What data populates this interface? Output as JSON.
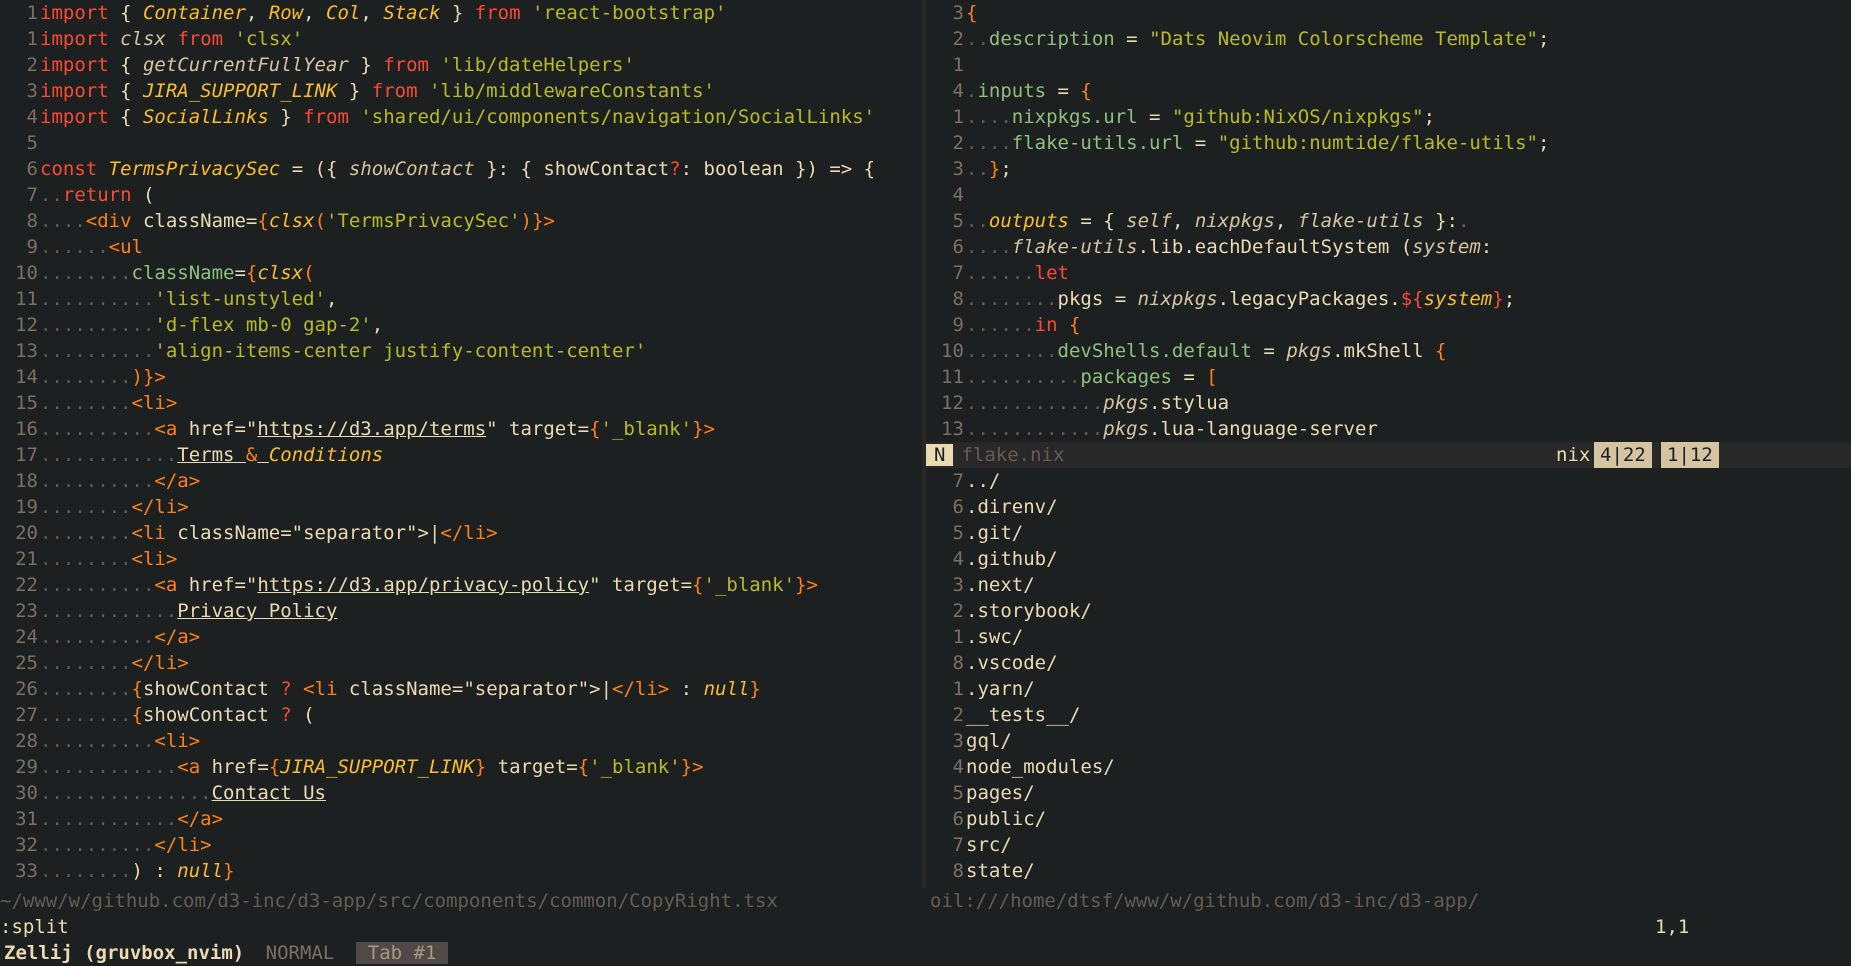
{
  "left": {
    "lines": [
      {
        "n": "1",
        "segs": [
          [
            "kw",
            "import"
          ],
          [
            "plain",
            " { "
          ],
          [
            "id",
            "Container"
          ],
          [
            "plain",
            ", "
          ],
          [
            "id",
            "Row"
          ],
          [
            "plain",
            ", "
          ],
          [
            "id",
            "Col"
          ],
          [
            "plain",
            ", "
          ],
          [
            "id",
            "Stack"
          ],
          [
            "plain",
            " } "
          ],
          [
            "kw",
            "from"
          ],
          [
            "plain",
            " "
          ],
          [
            "str",
            "'react-bootstrap'"
          ]
        ]
      },
      {
        "n": "1",
        "segs": [
          [
            "kw",
            "import"
          ],
          [
            "plain",
            " "
          ],
          [
            "it",
            "clsx"
          ],
          [
            "plain",
            " "
          ],
          [
            "kw",
            "from"
          ],
          [
            "plain",
            " "
          ],
          [
            "str",
            "'clsx'"
          ]
        ]
      },
      {
        "n": "2",
        "segs": [
          [
            "kw",
            "import"
          ],
          [
            "plain",
            " { "
          ],
          [
            "it",
            "getCurrentFullYear"
          ],
          [
            "plain",
            " } "
          ],
          [
            "kw",
            "from"
          ],
          [
            "plain",
            " "
          ],
          [
            "str",
            "'lib/dateHelpers'"
          ]
        ]
      },
      {
        "n": "3",
        "segs": [
          [
            "kw",
            "import"
          ],
          [
            "plain",
            " { "
          ],
          [
            "id",
            "JIRA_SUPPORT_LINK"
          ],
          [
            "plain",
            " } "
          ],
          [
            "kw",
            "from"
          ],
          [
            "plain",
            " "
          ],
          [
            "str",
            "'lib/middlewareConstants'"
          ]
        ]
      },
      {
        "n": "4",
        "segs": [
          [
            "kw",
            "import"
          ],
          [
            "plain",
            " { "
          ],
          [
            "id",
            "SocialLinks"
          ],
          [
            "plain",
            " } "
          ],
          [
            "kw",
            "from"
          ],
          [
            "plain",
            " "
          ],
          [
            "str",
            "'shared/ui/components/navigation/SocialLinks'"
          ]
        ]
      },
      {
        "n": "5",
        "segs": []
      },
      {
        "n": "6",
        "segs": [
          [
            "kw",
            "const"
          ],
          [
            "plain",
            " "
          ],
          [
            "id",
            "TermsPrivacySec"
          ],
          [
            "plain",
            " = ({ "
          ],
          [
            "it",
            "showContact"
          ],
          [
            "plain",
            " }: { showContact"
          ],
          [
            "kw",
            "?"
          ],
          [
            "plain",
            ": boolean }) => {"
          ]
        ]
      },
      {
        "n": "7",
        "segs": [
          [
            "dot",
            ".."
          ],
          [
            "kw",
            "return"
          ],
          [
            "plain",
            " ("
          ]
        ]
      },
      {
        "n": "8",
        "segs": [
          [
            "dot",
            "...."
          ],
          [
            "jsx",
            "<div"
          ],
          [
            "plain",
            " className="
          ],
          [
            "jsx",
            "{"
          ],
          [
            "id",
            "clsx"
          ],
          [
            "jsx",
            "("
          ],
          [
            "str",
            "'TermsPrivacySec'"
          ],
          [
            "jsx",
            ")}"
          ],
          [
            "jsx",
            ">"
          ]
        ]
      },
      {
        "n": "9",
        "segs": [
          [
            "dot",
            "......"
          ],
          [
            "jsx",
            "<ul"
          ]
        ]
      },
      {
        "n": "10",
        "segs": [
          [
            "dot",
            "........"
          ],
          [
            "attr",
            "className"
          ],
          [
            "plain",
            "="
          ],
          [
            "jsx",
            "{"
          ],
          [
            "id",
            "clsx"
          ],
          [
            "jsx",
            "("
          ]
        ]
      },
      {
        "n": "11",
        "segs": [
          [
            "dot",
            ".........."
          ],
          [
            "str",
            "'list-unstyled'"
          ],
          [
            "plain",
            ","
          ]
        ]
      },
      {
        "n": "12",
        "segs": [
          [
            "dot",
            ".........."
          ],
          [
            "str",
            "'d-flex mb-0 gap-2'"
          ],
          [
            "plain",
            ","
          ]
        ]
      },
      {
        "n": "13",
        "segs": [
          [
            "dot",
            ".........."
          ],
          [
            "str",
            "'align-items-center justify-content-center'"
          ]
        ]
      },
      {
        "n": "14",
        "segs": [
          [
            "dot",
            "........"
          ],
          [
            "jsx",
            ")}>"
          ]
        ]
      },
      {
        "n": "15",
        "segs": [
          [
            "dot",
            "........"
          ],
          [
            "jsx",
            "<li>"
          ]
        ]
      },
      {
        "n": "16",
        "segs": [
          [
            "dot",
            ".........."
          ],
          [
            "jsx",
            "<a"
          ],
          [
            "plain",
            " href=\""
          ],
          [
            "link",
            "https://d3.app/terms"
          ],
          [
            "plain",
            "\" target="
          ],
          [
            "jsx",
            "{"
          ],
          [
            "str",
            "'_blank'"
          ],
          [
            "jsx",
            "}>"
          ]
        ]
      },
      {
        "n": "17",
        "segs": [
          [
            "dot",
            "............"
          ],
          [
            "link",
            "Terms "
          ],
          [
            "jsx",
            "&"
          ],
          [
            "link",
            " "
          ],
          [
            "id",
            "Conditions"
          ]
        ]
      },
      {
        "n": "18",
        "segs": [
          [
            "dot",
            ".........."
          ],
          [
            "jsx",
            "</a>"
          ]
        ]
      },
      {
        "n": "19",
        "segs": [
          [
            "dot",
            "........"
          ],
          [
            "jsx",
            "</li>"
          ]
        ]
      },
      {
        "n": "20",
        "segs": [
          [
            "dot",
            "........"
          ],
          [
            "jsx",
            "<li"
          ],
          [
            "plain",
            " className=\"separator\">|"
          ],
          [
            "jsx",
            "</li>"
          ]
        ]
      },
      {
        "n": "21",
        "segs": [
          [
            "dot",
            "........"
          ],
          [
            "jsx",
            "<li>"
          ]
        ]
      },
      {
        "n": "22",
        "segs": [
          [
            "dot",
            ".........."
          ],
          [
            "jsx",
            "<a"
          ],
          [
            "plain",
            " href=\""
          ],
          [
            "link",
            "https://d3.app/privacy-policy"
          ],
          [
            "plain",
            "\" target="
          ],
          [
            "jsx",
            "{"
          ],
          [
            "str",
            "'_blank'"
          ],
          [
            "jsx",
            "}>"
          ]
        ]
      },
      {
        "n": "23",
        "segs": [
          [
            "dot",
            "............"
          ],
          [
            "link",
            "Privacy Policy"
          ]
        ]
      },
      {
        "n": "24",
        "segs": [
          [
            "dot",
            ".........."
          ],
          [
            "jsx",
            "</a>"
          ]
        ]
      },
      {
        "n": "25",
        "segs": [
          [
            "dot",
            "........"
          ],
          [
            "jsx",
            "</li>"
          ]
        ]
      },
      {
        "n": "26",
        "segs": [
          [
            "dot",
            "........"
          ],
          [
            "jsx",
            "{"
          ],
          [
            "plain",
            "showContact "
          ],
          [
            "kw",
            "?"
          ],
          [
            "plain",
            " "
          ],
          [
            "jsx",
            "<li"
          ],
          [
            "plain",
            " className=\"separator\">|"
          ],
          [
            "jsx",
            "</li>"
          ],
          [
            "plain",
            " : "
          ],
          [
            "id",
            "null"
          ],
          [
            "jsx",
            "}"
          ]
        ]
      },
      {
        "n": "27",
        "segs": [
          [
            "dot",
            "........"
          ],
          [
            "jsx",
            "{"
          ],
          [
            "plain",
            "showContact "
          ],
          [
            "kw",
            "?"
          ],
          [
            "plain",
            " ("
          ]
        ]
      },
      {
        "n": "28",
        "segs": [
          [
            "dot",
            ".........."
          ],
          [
            "jsx",
            "<li>"
          ]
        ]
      },
      {
        "n": "29",
        "segs": [
          [
            "dot",
            "............"
          ],
          [
            "jsx",
            "<a"
          ],
          [
            "plain",
            " href="
          ],
          [
            "jsx",
            "{"
          ],
          [
            "id",
            "JIRA_SUPPORT_LINK"
          ],
          [
            "jsx",
            "}"
          ],
          [
            "plain",
            " target="
          ],
          [
            "jsx",
            "{"
          ],
          [
            "str",
            "'_blank'"
          ],
          [
            "jsx",
            "}>"
          ]
        ]
      },
      {
        "n": "30",
        "segs": [
          [
            "dot",
            "..............."
          ],
          [
            "link",
            "Contact Us"
          ]
        ]
      },
      {
        "n": "31",
        "segs": [
          [
            "dot",
            "............"
          ],
          [
            "jsx",
            "</a>"
          ]
        ]
      },
      {
        "n": "32",
        "segs": [
          [
            "dot",
            ".........."
          ],
          [
            "jsx",
            "</li>"
          ]
        ]
      },
      {
        "n": "33",
        "segs": [
          [
            "dot",
            "........"
          ],
          [
            "plain",
            ") : "
          ],
          [
            "id",
            "null"
          ],
          [
            "jsx",
            "}"
          ]
        ]
      }
    ],
    "status_path": "~/www/w/github.com/d3-inc/d3-app/src/components/common/CopyRight.tsx"
  },
  "right": {
    "lines": [
      {
        "n": "3",
        "segs": [
          [
            "jsx",
            "{"
          ]
        ]
      },
      {
        "n": "2",
        "segs": [
          [
            "dot",
            ".."
          ],
          [
            "attr",
            "description"
          ],
          [
            "plain",
            " = "
          ],
          [
            "str",
            "\"Dats Neovim Colorscheme Template\""
          ],
          [
            "plain",
            ";"
          ]
        ]
      },
      {
        "n": "1",
        "segs": []
      },
      {
        "n": "4",
        "segs": [
          [
            "dot",
            "."
          ],
          [
            "attr",
            "inputs"
          ],
          [
            "plain",
            " = "
          ],
          [
            "jsx",
            "{"
          ]
        ]
      },
      {
        "n": "1",
        "segs": [
          [
            "dot",
            "...."
          ],
          [
            "attr",
            "nixpkgs.url"
          ],
          [
            "plain",
            " = "
          ],
          [
            "str",
            "\"github:NixOS/nixpkgs\""
          ],
          [
            "plain",
            ";"
          ]
        ]
      },
      {
        "n": "2",
        "segs": [
          [
            "dot",
            "...."
          ],
          [
            "attr",
            "flake-utils.url"
          ],
          [
            "plain",
            " = "
          ],
          [
            "str",
            "\"github:numtide/flake-utils\""
          ],
          [
            "plain",
            ";"
          ]
        ]
      },
      {
        "n": "3",
        "segs": [
          [
            "dot",
            ".."
          ],
          [
            "jsx",
            "}"
          ],
          [
            "plain",
            ";"
          ]
        ]
      },
      {
        "n": "4",
        "segs": []
      },
      {
        "n": "5",
        "segs": [
          [
            "dot",
            ".."
          ],
          [
            "id",
            "outputs"
          ],
          [
            "plain",
            " = { "
          ],
          [
            "it",
            "self"
          ],
          [
            "plain",
            ", "
          ],
          [
            "it",
            "nixpkgs"
          ],
          [
            "plain",
            ", "
          ],
          [
            "it",
            "flake-utils"
          ],
          [
            "plain",
            " }:"
          ],
          [
            "dot",
            "."
          ]
        ]
      },
      {
        "n": "6",
        "segs": [
          [
            "dot",
            "...."
          ],
          [
            "it",
            "flake-utils"
          ],
          [
            "plain",
            ".lib.eachDefaultSystem ("
          ],
          [
            "it",
            "system"
          ],
          [
            "plain",
            ":"
          ]
        ]
      },
      {
        "n": "7",
        "segs": [
          [
            "dot",
            "......"
          ],
          [
            "kw",
            "let"
          ]
        ]
      },
      {
        "n": "8",
        "segs": [
          [
            "dot",
            "........"
          ],
          [
            "plain",
            "pkgs = "
          ],
          [
            "it",
            "nixpkgs"
          ],
          [
            "plain",
            ".legacyPackages."
          ],
          [
            "kw",
            "${"
          ],
          [
            "id",
            "system"
          ],
          [
            "kw",
            "}"
          ],
          [
            "plain",
            ";"
          ]
        ]
      },
      {
        "n": "9",
        "segs": [
          [
            "dot",
            "......"
          ],
          [
            "kw",
            "in"
          ],
          [
            "plain",
            " "
          ],
          [
            "jsx",
            "{"
          ]
        ]
      },
      {
        "n": "10",
        "segs": [
          [
            "dot",
            "........"
          ],
          [
            "attr",
            "devShells.default"
          ],
          [
            "plain",
            " = "
          ],
          [
            "it",
            "pkgs"
          ],
          [
            "plain",
            ".mkShell "
          ],
          [
            "jsx",
            "{"
          ]
        ]
      },
      {
        "n": "11",
        "segs": [
          [
            "dot",
            ".........."
          ],
          [
            "attr",
            "packages"
          ],
          [
            "plain",
            " = "
          ],
          [
            "jsx",
            "["
          ]
        ]
      },
      {
        "n": "12",
        "segs": [
          [
            "dot",
            "............"
          ],
          [
            "it",
            "pkgs"
          ],
          [
            "plain",
            ".stylua"
          ]
        ]
      },
      {
        "n": "13",
        "segs": [
          [
            "dot",
            "............"
          ],
          [
            "it",
            "pkgs"
          ],
          [
            "plain",
            ".lua-language-server"
          ]
        ]
      }
    ],
    "status": {
      "mode": "N",
      "file": "flake.nix",
      "filetype": "nix",
      "progress": "4|22",
      "position": "1|12"
    },
    "oil": [
      {
        "n": "7",
        "name": "../"
      },
      {
        "n": "6",
        "name": ".direnv/"
      },
      {
        "n": "5",
        "name": ".git/"
      },
      {
        "n": "4",
        "name": ".github/"
      },
      {
        "n": "3",
        "name": ".next/"
      },
      {
        "n": "2",
        "name": ".storybook/"
      },
      {
        "n": "1",
        "name": ".swc/"
      },
      {
        "n": "8",
        "name": ".vscode/"
      },
      {
        "n": "1",
        "name": ".yarn/"
      },
      {
        "n": "2",
        "name": "__tests__/"
      },
      {
        "n": "3",
        "name": "gql/"
      },
      {
        "n": "4",
        "name": "node_modules/"
      },
      {
        "n": "5",
        "name": "pages/"
      },
      {
        "n": "6",
        "name": "public/"
      },
      {
        "n": "7",
        "name": "src/"
      },
      {
        "n": "8",
        "name": "state/"
      }
    ],
    "oil_path": "oil:///home/dtsf/www/w/github.com/d3-inc/d3-app/"
  },
  "cmdline": {
    "text": ":split",
    "cursor": "1,1"
  },
  "zellij": {
    "session": "Zellij (gruvbox_nvim)",
    "mode": "NORMAL",
    "tab": "Tab #1"
  }
}
